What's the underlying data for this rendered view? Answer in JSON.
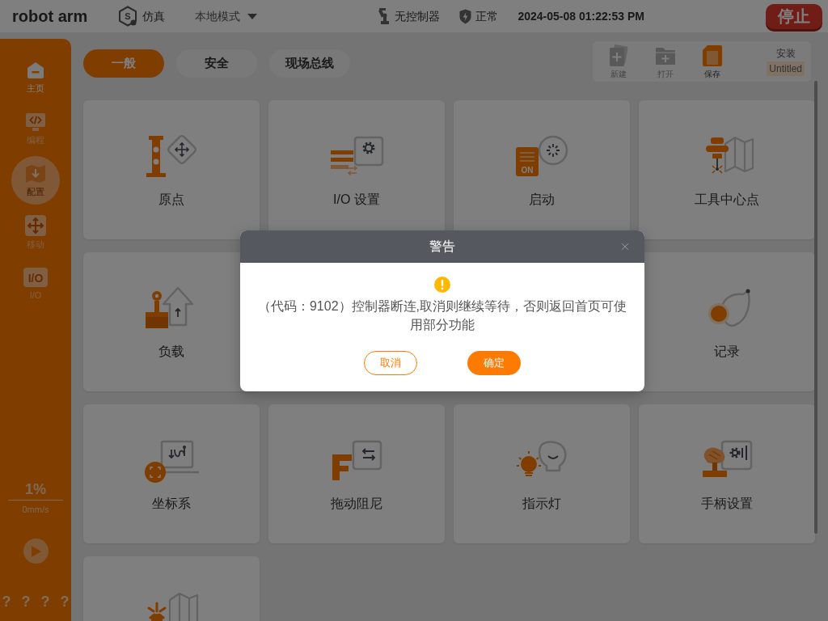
{
  "app": {
    "title": "robot arm"
  },
  "top_bar": {
    "mode": {
      "icon_text": "S",
      "label": "仿真"
    },
    "mode_dropdown": {
      "value": "本地模式"
    },
    "controller": "无控制器",
    "status": "正常",
    "datetime": "2024-05-08 01:22:53 PM",
    "stop_button": "停止"
  },
  "sidebar": {
    "items": [
      {
        "label": "主页",
        "selected": false,
        "disabled": false
      },
      {
        "label": "编程",
        "selected": false,
        "disabled": true
      },
      {
        "label": "配置",
        "selected": true,
        "disabled": false
      },
      {
        "label": "移动",
        "selected": false,
        "disabled": true
      },
      {
        "label": "I/O",
        "icon_text": "I/O",
        "selected": false,
        "disabled": true
      }
    ],
    "speed": {
      "percent": "1%",
      "velocity": "0mm/s"
    },
    "help": "? ? ? ?"
  },
  "tabs": [
    {
      "label": "一般",
      "selected": true
    },
    {
      "label": "安全",
      "selected": false
    },
    {
      "label": "现场总线",
      "selected": false
    }
  ],
  "file_toolbar": {
    "buttons": [
      {
        "label": "新建",
        "disabled": true
      },
      {
        "label": "打开",
        "disabled": true
      },
      {
        "label": "保存",
        "disabled": false
      }
    ],
    "installation": {
      "label": "安装",
      "value": "Untitled"
    }
  },
  "tiles": [
    {
      "label": "原点"
    },
    {
      "label": "I/O 设置"
    },
    {
      "label": "启动",
      "icon_text": "ON"
    },
    {
      "label": "工具中心点"
    },
    {
      "label": "负载"
    },
    {
      "label": "记录"
    },
    {
      "label": "坐标系"
    },
    {
      "label": "拖动阻尼"
    },
    {
      "label": "指示灯"
    },
    {
      "label": "手柄设置"
    }
  ],
  "dialog": {
    "title": "警告",
    "message": "（代码：9102）控制器断连,取消则继续等待，否则返回首页可使用部分功能",
    "buttons": [
      {
        "label": "取消",
        "kind": "outline"
      },
      {
        "label": "确定",
        "kind": "primary"
      }
    ]
  }
}
